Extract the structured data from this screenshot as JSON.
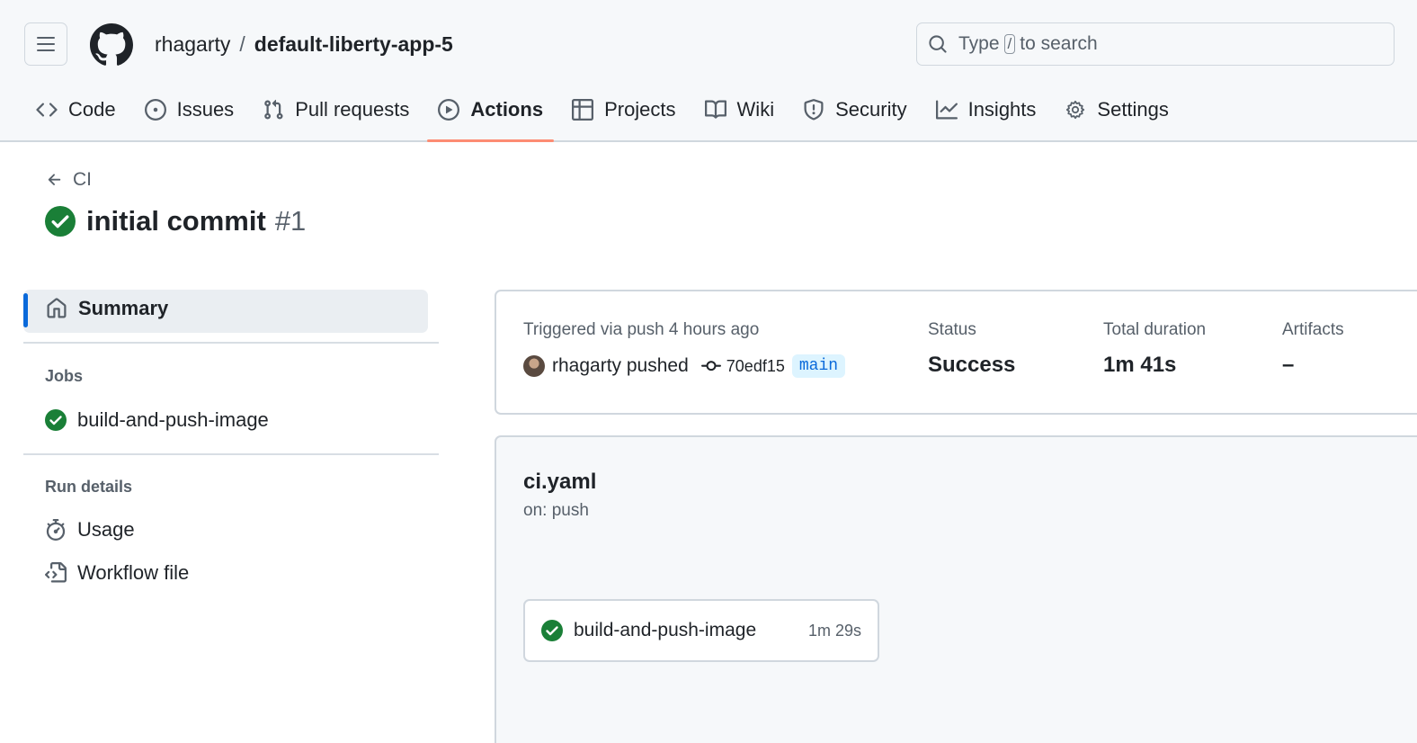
{
  "header": {
    "owner": "rhagarty",
    "separator": "/",
    "repo": "default-liberty-app-5",
    "search": {
      "prefix": "Type",
      "key": "/",
      "suffix": "to search"
    }
  },
  "tabs": [
    {
      "label": "Code",
      "icon": "code-icon"
    },
    {
      "label": "Issues",
      "icon": "issue-icon"
    },
    {
      "label": "Pull requests",
      "icon": "pull-request-icon"
    },
    {
      "label": "Actions",
      "icon": "play-icon",
      "active": true
    },
    {
      "label": "Projects",
      "icon": "table-icon"
    },
    {
      "label": "Wiki",
      "icon": "book-icon"
    },
    {
      "label": "Security",
      "icon": "shield-icon"
    },
    {
      "label": "Insights",
      "icon": "graph-icon"
    },
    {
      "label": "Settings",
      "icon": "gear-icon"
    }
  ],
  "back": {
    "label": "CI"
  },
  "run": {
    "title": "initial commit",
    "number": "#1"
  },
  "sidebar": {
    "summary": "Summary",
    "jobs_heading": "Jobs",
    "jobs": [
      "build-and-push-image"
    ],
    "run_details_heading": "Run details",
    "run_details": [
      "Usage",
      "Workflow file"
    ]
  },
  "summary": {
    "trigger": "Triggered via push 4 hours ago",
    "actor": "rhagarty pushed",
    "sha": "70edf15",
    "branch": "main",
    "status_label": "Status",
    "status_value": "Success",
    "duration_label": "Total duration",
    "duration_value": "1m 41s",
    "artifacts_label": "Artifacts",
    "artifacts_value": "–"
  },
  "workflow": {
    "name": "ci.yaml",
    "trigger": "on: push",
    "job": {
      "name": "build-and-push-image",
      "duration": "1m 29s"
    }
  },
  "colors": {
    "success": "#1a7f37",
    "accent": "#0969da",
    "tab_underline": "#fd8c73"
  }
}
